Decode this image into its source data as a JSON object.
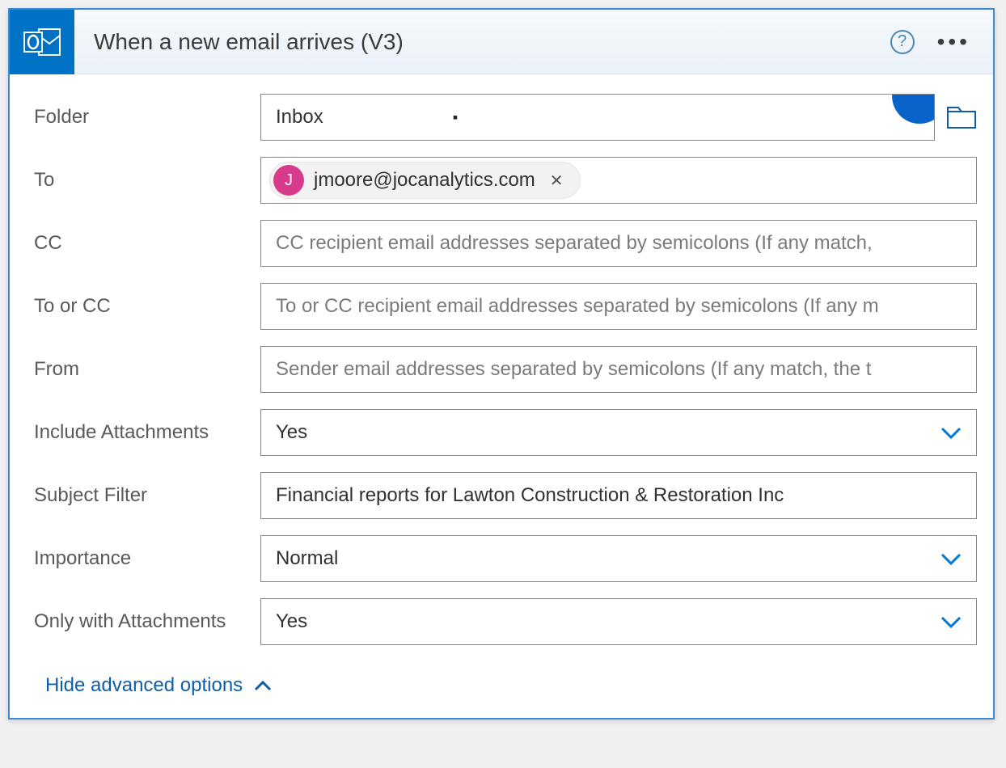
{
  "header": {
    "title": "When a new email arrives (V3)"
  },
  "fields": {
    "folder": {
      "label": "Folder",
      "value": "Inbox"
    },
    "to": {
      "label": "To",
      "chip": {
        "initial": "J",
        "email": "jmoore@jocanalytics.com"
      }
    },
    "cc": {
      "label": "CC",
      "placeholder": "CC recipient email addresses separated by semicolons (If any match,"
    },
    "to_or_cc": {
      "label": "To or CC",
      "placeholder": "To or CC recipient email addresses separated by semicolons (If any m"
    },
    "from": {
      "label": "From",
      "placeholder": "Sender email addresses separated by semicolons (If any match, the t"
    },
    "include_attachments": {
      "label": "Include Attachments",
      "value": "Yes"
    },
    "subject_filter": {
      "label": "Subject Filter",
      "value": "Financial reports for Lawton Construction & Restoration Inc"
    },
    "importance": {
      "label": "Importance",
      "value": "Normal"
    },
    "only_with_attachments": {
      "label": "Only with Attachments",
      "value": "Yes"
    }
  },
  "footer": {
    "hide_advanced": "Hide advanced options"
  }
}
